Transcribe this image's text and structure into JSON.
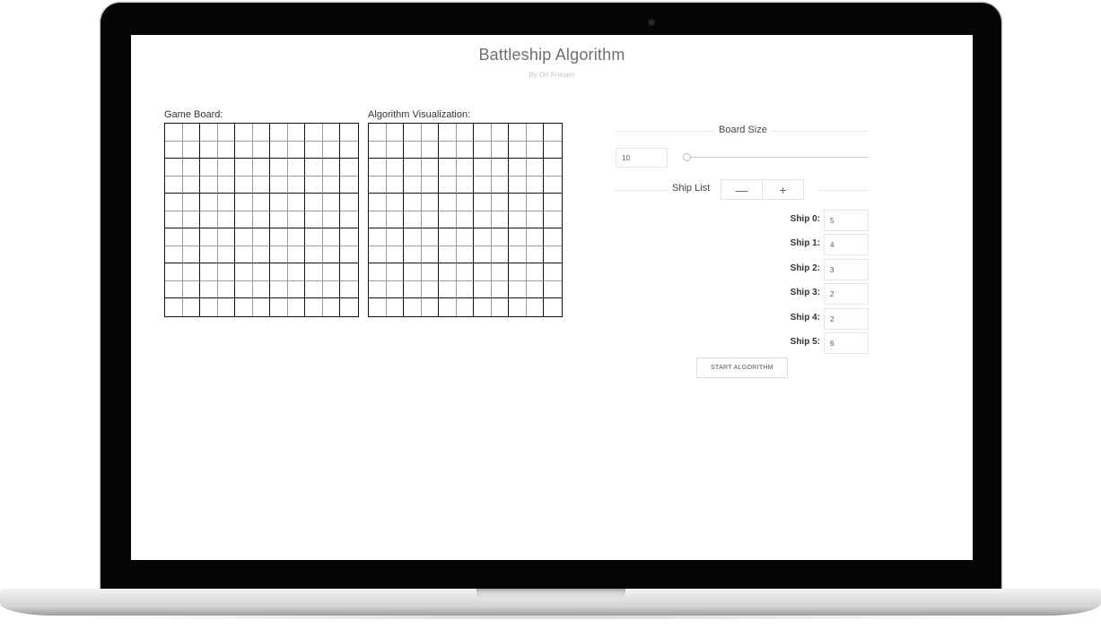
{
  "header": {
    "title": "Battleship Algorithm",
    "subtitle": "By Ori Friesen"
  },
  "boards": {
    "game_label": "Game Board:",
    "viz_label": "Algorithm Visualization:"
  },
  "board_size": {
    "heading": "Board Size",
    "value": "10",
    "slider_level": 0
  },
  "ship_list": {
    "heading": "Ship List",
    "remove_symbol": "—",
    "add_symbol": "+",
    "ships": [
      {
        "label": "Ship 0:",
        "value": "5"
      },
      {
        "label": "Ship 1:",
        "value": "4"
      },
      {
        "label": "Ship 2:",
        "value": "3"
      },
      {
        "label": "Ship 3:",
        "value": "2"
      },
      {
        "label": "Ship 4:",
        "value": "2"
      },
      {
        "label": "Ship 5:",
        "value": "6"
      }
    ]
  },
  "actions": {
    "start_label": "START ALGORITHM"
  }
}
